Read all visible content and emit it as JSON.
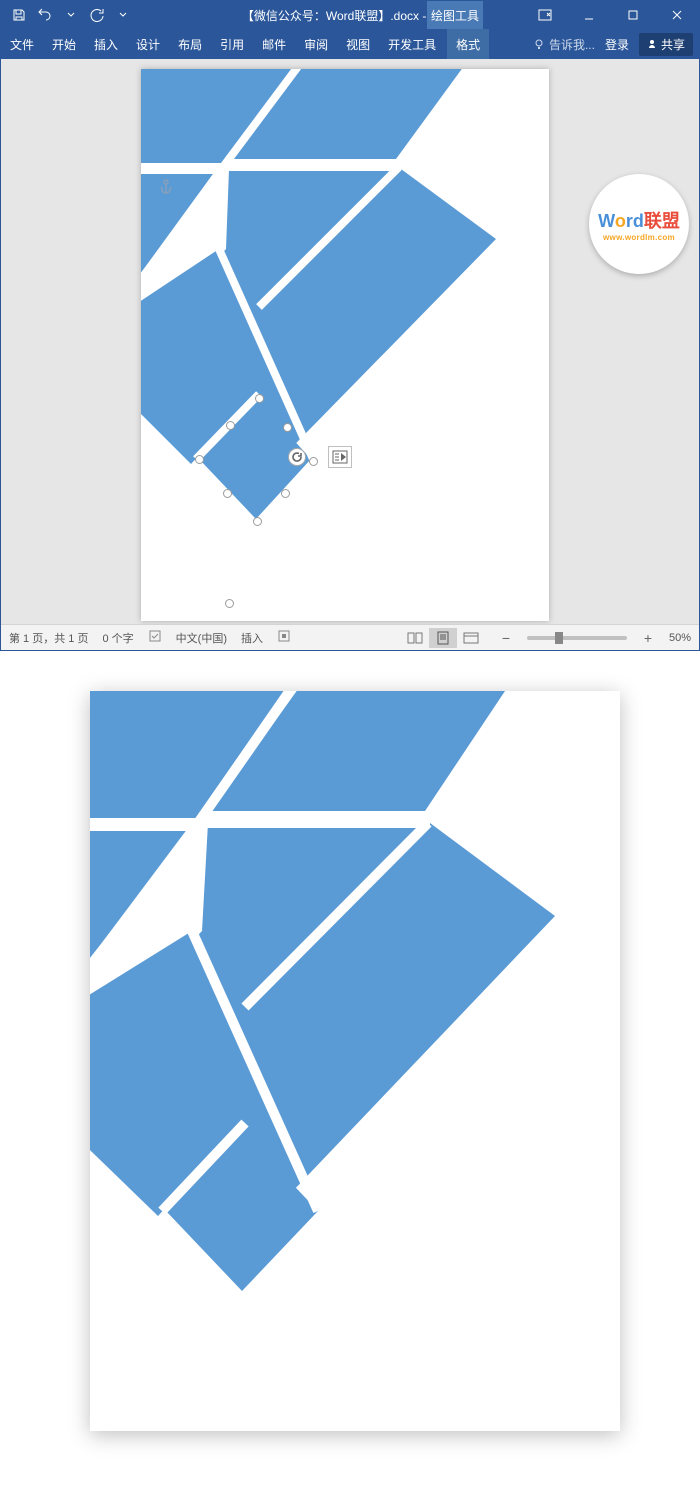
{
  "qat": {
    "save": "保存",
    "undo": "撤销",
    "redo": "恢复"
  },
  "title": "【微信公众号：Word联盟】.docx - Word",
  "contextual_tab_group": "绘图工具",
  "window_controls": {
    "ribbon_opts": "功能区选项",
    "min": "最小化",
    "max": "还原",
    "close": "关闭"
  },
  "ribbon_tabs": {
    "file": "文件",
    "home": "开始",
    "insert": "插入",
    "design": "设计",
    "layout": "布局",
    "references": "引用",
    "mailings": "邮件",
    "review": "审阅",
    "view": "视图",
    "developer": "开发工具",
    "format": "格式"
  },
  "tell_me": "告诉我...",
  "sign_in": "登录",
  "share": "共享",
  "statusbar": {
    "page": "第 1 页，共 1 页",
    "words": "0 个字",
    "lang": "中文(中国)",
    "mode": "插入",
    "zoom": "50%"
  },
  "logo": {
    "line1_word": "Word",
    "line1_cn": "联盟",
    "line2": "www.wordlm.com"
  },
  "colors": {
    "ribbon": "#2b579a",
    "accent": "#4a7ab5",
    "shape": "#5b9bd5"
  }
}
